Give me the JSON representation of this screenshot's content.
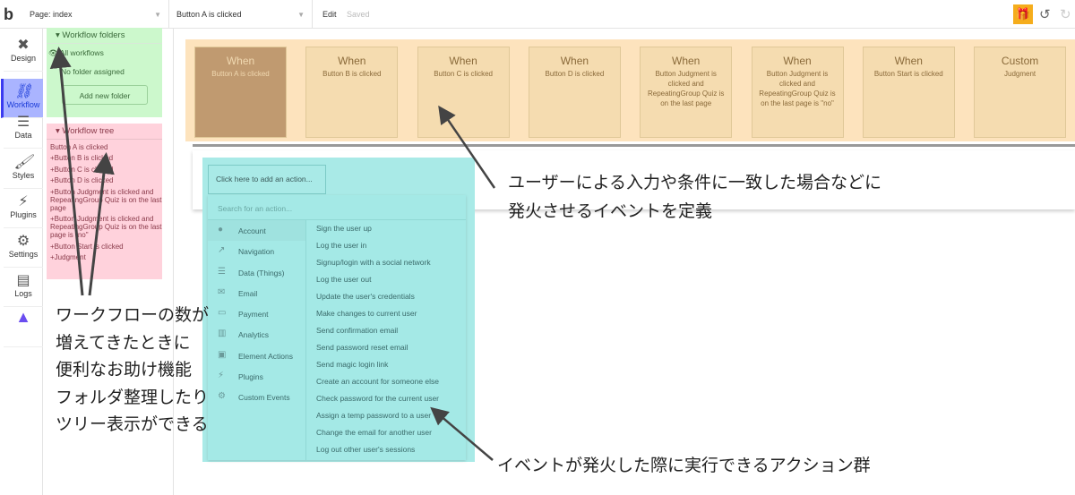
{
  "topbar": {
    "logo": "b",
    "page": "Page: index",
    "workflow": "Button A is clicked",
    "edit": "Edit",
    "saved": "Saved"
  },
  "icons": {
    "gift": "gift-icon",
    "undo": "undo-icon",
    "redo": "redo-icon"
  },
  "nav": [
    {
      "label": "Design"
    },
    {
      "label": "Workflow"
    },
    {
      "label": "Data"
    },
    {
      "label": "Styles"
    },
    {
      "label": "Plugins"
    },
    {
      "label": "Settings"
    },
    {
      "label": "Logs"
    }
  ],
  "folders": {
    "title": "Workflow folders",
    "all": "All workflows",
    "none": "No folder assigned",
    "add": "Add new folder"
  },
  "tree": {
    "title": "Workflow tree",
    "items": [
      "Button A is clicked",
      "Button B is clicked",
      "Button C is clicked",
      "Button D is clicked",
      "Button Judgment is clicked and RepeatingGroup Quiz is on the last page",
      "Button Judgment is clicked and RepeatingGroup Quiz is on the last page is \"no\"",
      "Button Start is clicked",
      "Judgment"
    ]
  },
  "events": [
    {
      "type": "When",
      "desc": "Button A is clicked"
    },
    {
      "type": "When",
      "desc": "Button B is clicked"
    },
    {
      "type": "When",
      "desc": "Button C is clicked"
    },
    {
      "type": "When",
      "desc": "Button D is clicked"
    },
    {
      "type": "When",
      "desc": "Button Judgment is clicked and RepeatingGroup Quiz is on the last page"
    },
    {
      "type": "When",
      "desc": "Button Judgment is clicked and RepeatingGroup Quiz is on the last page is \"no\""
    },
    {
      "type": "When",
      "desc": "Button Start is clicked"
    },
    {
      "type": "Custom",
      "desc": "Judgment"
    }
  ],
  "actions": {
    "add": "Click here to add an action...",
    "search_placeholder": "Search for an action...",
    "categories": [
      "Account",
      "Navigation",
      "Data (Things)",
      "Email",
      "Payment",
      "Analytics",
      "Element Actions",
      "Plugins",
      "Custom Events"
    ],
    "items": [
      "Sign the user up",
      "Log the user in",
      "Signup/login with a social network",
      "Log the user out",
      "Update the user's credentials",
      "Make changes to current user",
      "Send confirmation email",
      "Send password reset email",
      "Send magic login link",
      "Create an account for someone else",
      "Check password for the current user",
      "Assign a temp password to a user",
      "Change the email for another user",
      "Log out other user's sessions"
    ]
  },
  "annotations": {
    "events": [
      "ユーザーによる入力や条件に一致した場合などに",
      "発火させるイベントを定義"
    ],
    "folders": [
      "ワークフローの数が",
      "増えてきたときに",
      "便利なお助け機能",
      "フォルダ整理したり",
      "ツリー表示ができる"
    ],
    "actions": "イベントが発火した際に実行できるアクション群"
  }
}
